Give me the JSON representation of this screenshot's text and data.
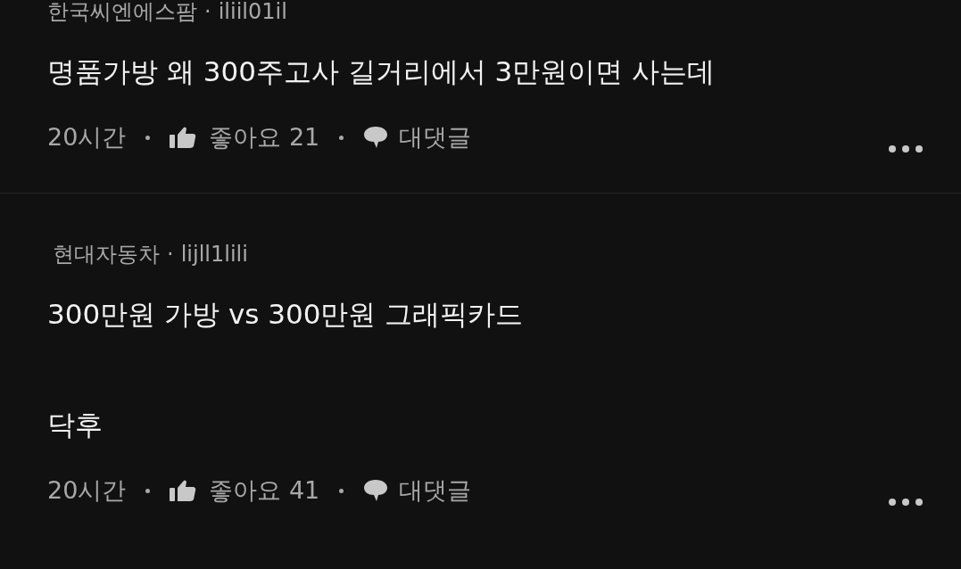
{
  "comments": [
    {
      "company": "한국씨엔에스팜",
      "separator": "·",
      "user": "iliil01il",
      "paragraphs": [
        "명품가방 왜 300주고사 길거리에서 3만원이면 사는데"
      ],
      "time": "20시간",
      "likes": "좋아요 21",
      "reply": "대댓글"
    },
    {
      "company": "현대자동차",
      "separator": "·",
      "user": "lijll1lili",
      "paragraphs": [
        "300만원 가방 vs 300만원 그래픽카드",
        "닥후"
      ],
      "time": "20시간",
      "likes": "좋아요 41",
      "reply": "대댓글"
    }
  ]
}
